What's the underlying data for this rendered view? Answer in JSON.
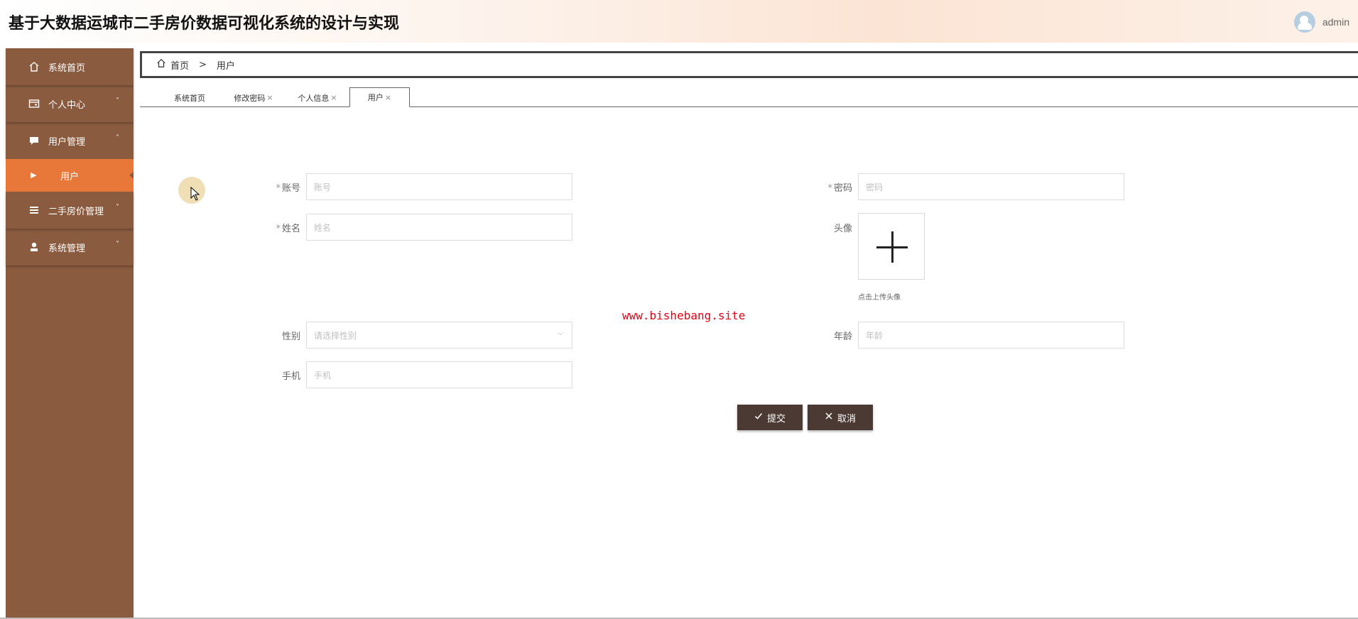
{
  "header": {
    "title": "基于大数据运城市二手房价数据可视化系统的设计与实现",
    "username": "admin"
  },
  "sidebar": {
    "items": [
      {
        "label": "系统首页",
        "icon": "home-icon"
      },
      {
        "label": "个人中心",
        "icon": "wallet-icon",
        "arrow": "˅"
      },
      {
        "label": "用户管理",
        "icon": "chat-icon",
        "arrow": "˄"
      },
      {
        "label": "二手房价管理",
        "icon": "list-icon",
        "arrow": "˅"
      },
      {
        "label": "系统管理",
        "icon": "person-icon",
        "arrow": "˅"
      }
    ],
    "submenu": {
      "label": "用户"
    }
  },
  "breadcrumb": {
    "home": "首页",
    "separator": ">",
    "current": "用户"
  },
  "tabs": [
    {
      "label": "系统首页",
      "close": ""
    },
    {
      "label": "修改密码",
      "close": "×"
    },
    {
      "label": "个人信息",
      "close": "×"
    },
    {
      "label": "用户",
      "close": "×"
    }
  ],
  "form": {
    "account": {
      "label": "账号",
      "required": "*",
      "placeholder": "账号"
    },
    "password": {
      "label": "密码",
      "required": "*",
      "placeholder": "密码"
    },
    "name": {
      "label": "姓名",
      "required": "*",
      "placeholder": "姓名"
    },
    "avatar": {
      "label": "头像",
      "tip": "点击上传头像"
    },
    "gender": {
      "label": "性别",
      "placeholder": "请选择性别"
    },
    "age": {
      "label": "年龄",
      "placeholder": "年龄"
    },
    "phone": {
      "label": "手机",
      "placeholder": "手机"
    }
  },
  "buttons": {
    "submit": "提交",
    "cancel": "取消"
  },
  "watermark": "www.bishebang.site",
  "colors": {
    "sidebar_bg": "#8b5b3f",
    "sidebar_active": "#e8783a",
    "button_bg": "#4a3a33",
    "watermark": "#e60012"
  }
}
